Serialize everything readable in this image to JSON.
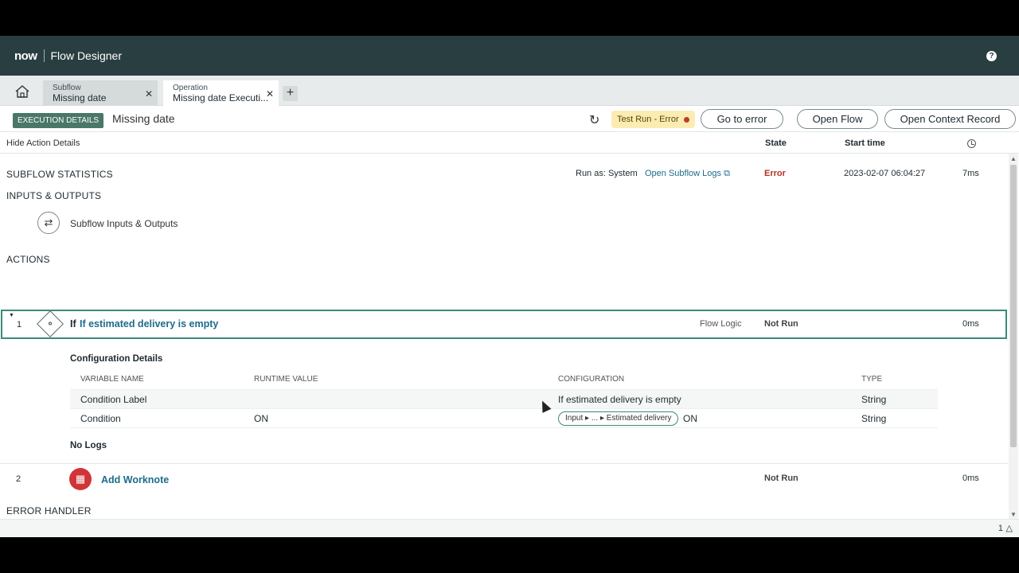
{
  "header": {
    "logo": "now",
    "title": "Flow Designer",
    "help_icon": "question-icon"
  },
  "tabs": [
    {
      "type": "Subflow",
      "name": "Missing date"
    },
    {
      "type": "Operation",
      "name": "Missing date Executi..."
    }
  ],
  "toolbar": {
    "execution_details": "EXECUTION DETAILS",
    "run_name": "Missing date",
    "status": "Test Run - Error",
    "status_color": "#c0392b",
    "go_to_error": "Go to error",
    "open_flow": "Open Flow",
    "open_context_record": "Open Context Record"
  },
  "columns": {
    "hide_action_details": "Hide Action Details",
    "state": "State",
    "start_time": "Start time"
  },
  "subflow_statistics": {
    "label": "SUBFLOW STATISTICS",
    "run_as": "Run as: System",
    "logs_link": "Open Subflow Logs",
    "state": "Error",
    "start_time": "2023-02-07 06:04:27",
    "duration": "7ms"
  },
  "inputs_outputs": {
    "label": "INPUTS & OUTPUTS",
    "item": "Subflow Inputs & Outputs"
  },
  "actions": {
    "label": "ACTIONS",
    "items": [
      {
        "number": "1",
        "prefix": "If",
        "name": "If estimated delivery is empty",
        "category": "Flow Logic",
        "state": "Not Run",
        "duration": "0ms"
      },
      {
        "number": "2",
        "name": "Add Worknote",
        "state": "Not Run",
        "duration": "0ms"
      }
    ]
  },
  "config": {
    "title": "Configuration Details",
    "headers": [
      "VARIABLE NAME",
      "RUNTIME VALUE",
      "CONFIGURATION",
      "TYPE"
    ],
    "rows": [
      {
        "variable": "Condition Label",
        "runtime": "",
        "configuration": "If estimated delivery is empty",
        "type": "String"
      },
      {
        "variable": "Condition",
        "runtime": "ON",
        "config_path": [
          "Input",
          "...",
          "Estimated delivery"
        ],
        "config_suffix": "ON",
        "type": "String"
      }
    ],
    "no_logs": "No Logs"
  },
  "error_handler": {
    "label": "ERROR HANDLER"
  },
  "footer": {
    "notifications": "1"
  }
}
